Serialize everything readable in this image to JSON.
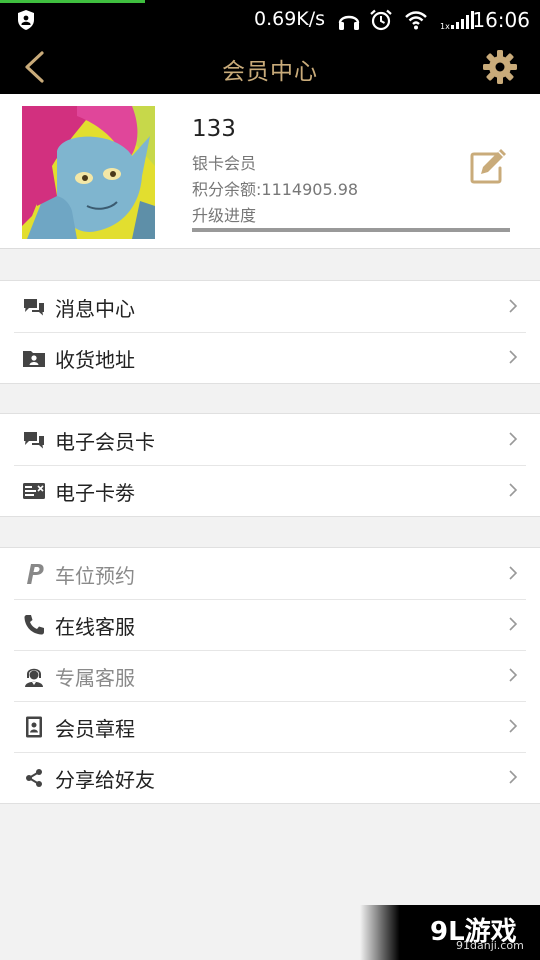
{
  "status_bar": {
    "speed": "0.69K/s",
    "time": "16:06",
    "icons": [
      "shield-icon",
      "headphones-icon",
      "alarm-icon",
      "wifi-icon",
      "signal-icon"
    ]
  },
  "header": {
    "title": "会员中心",
    "back_icon": "chevron-left-icon",
    "settings_icon": "gear-icon",
    "accent_color": "#c9ab7a"
  },
  "profile": {
    "username": "133",
    "member_level": "银卡会员",
    "points": "积分余额:1114905.98",
    "upgrade_label": "升级进度",
    "upgrade_progress": 1.0
  },
  "groups": [
    {
      "items": [
        {
          "label": "消息中心",
          "icon": "chat-bubbles-icon",
          "dim": false
        },
        {
          "label": "收货地址",
          "icon": "address-folder-icon",
          "dim": false
        }
      ]
    },
    {
      "items": [
        {
          "label": "电子会员卡",
          "icon": "chat-bubbles-icon",
          "dim": false
        },
        {
          "label": "电子卡劵",
          "icon": "ticket-icon",
          "dim": false
        }
      ]
    },
    {
      "items": [
        {
          "label": "车位预约",
          "icon": "parking-icon",
          "dim": true
        },
        {
          "label": "在线客服",
          "icon": "phone-icon",
          "dim": false
        },
        {
          "label": "专属客服",
          "icon": "agent-icon",
          "dim": true
        },
        {
          "label": "会员章程",
          "icon": "member-doc-icon",
          "dim": false
        },
        {
          "label": "分享给好友",
          "icon": "share-icon",
          "dim": false
        }
      ]
    }
  ],
  "watermark": {
    "logo": "9L游戏",
    "url": "91danji.com"
  }
}
